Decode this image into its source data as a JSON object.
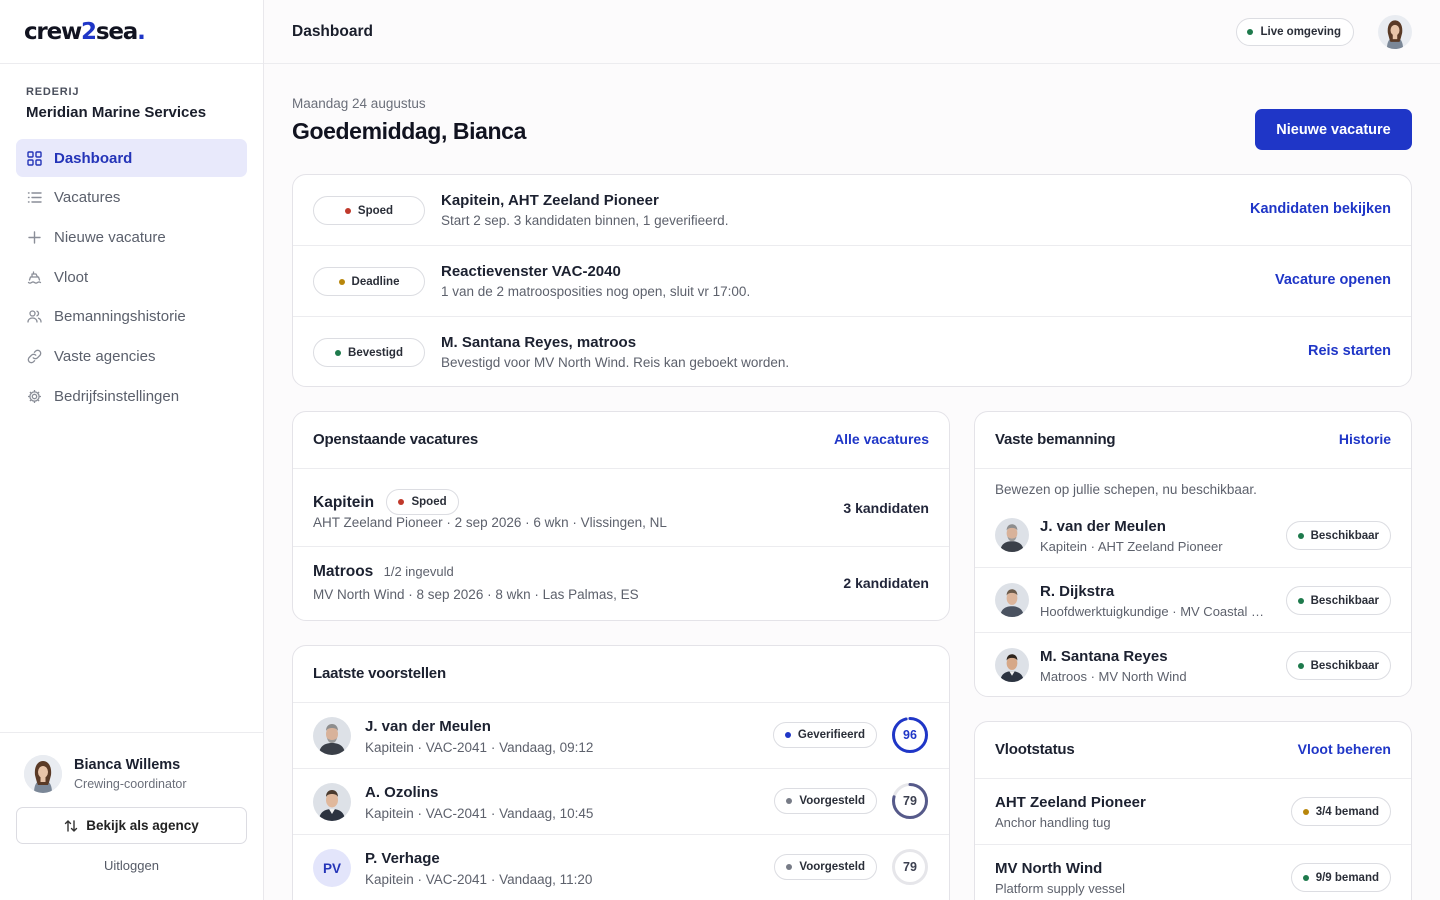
{
  "brand": {
    "prefix": "crew",
    "two": "2",
    "suffix": "sea",
    "dot": "."
  },
  "org": {
    "label": "REDERIJ",
    "name": "Meridian Marine Services"
  },
  "nav": {
    "items": [
      {
        "label": "Dashboard",
        "icon": "grid-icon",
        "active": true
      },
      {
        "label": "Vacatures",
        "icon": "list-icon"
      },
      {
        "label": "Nieuwe vacature",
        "icon": "plus-icon"
      },
      {
        "label": "Vloot",
        "icon": "ship-icon"
      },
      {
        "label": "Bemanningshistorie",
        "icon": "users-icon"
      },
      {
        "label": "Vaste agencies",
        "icon": "link-icon"
      },
      {
        "label": "Bedrijfsinstellingen",
        "icon": "gear-icon"
      }
    ]
  },
  "user": {
    "name": "Bianca Willems",
    "role": "Crewing-coordinator",
    "agency_button": "Bekijk als agency",
    "logout": "Uitloggen"
  },
  "header": {
    "title": "Dashboard",
    "env": "Live omgeving"
  },
  "main": {
    "date": "Maandag 24 augustus",
    "greeting": "Goedemiddag, Bianca",
    "new_button": "Nieuwe vacature"
  },
  "alerts": [
    {
      "badge": "Spoed",
      "title": "Kapitein, AHT Zeeland Pioneer",
      "sub": "Start 2 sep. 3 kandidaten binnen, 1 geverifieerd.",
      "action": "Kandidaten bekijken"
    },
    {
      "badge": "Deadline",
      "title": "Reactievenster VAC-2040",
      "sub": "1 van de 2 matroosposities nog open, sluit vr 17:00.",
      "action": "Vacature openen"
    },
    {
      "badge": "Bevestigd",
      "title": "M. Santana Reyes, matroos",
      "sub": "Bevestigd voor MV North Wind. Reis kan geboekt worden.",
      "action": "Reis starten"
    }
  ],
  "vacancies": {
    "title": "Openstaande vacatures",
    "link": "Alle vacatures",
    "rows": [
      {
        "title": "Kapitein",
        "tag": "Spoed",
        "sub": "AHT Zeeland Pioneer · 2 sep 2026 · 6 wkn · Vlissingen, NL",
        "count": "3 kandidaten"
      },
      {
        "title": "Matroos",
        "tag": "1/2 ingevuld",
        "sub": "MV North Wind · 8 sep 2026 · 8 wkn · Las Palmas, ES",
        "count": "2 kandidaten"
      }
    ]
  },
  "proposals": {
    "title": "Laatste voorstellen",
    "rows": [
      {
        "name": "J. van der Meulen",
        "sub": "Kapitein · VAC-2041 · Vandaag, 09:12",
        "status": "Geverifieerd",
        "score": 96,
        "score_pct": 0.96
      },
      {
        "name": "A. Ozolins",
        "sub": "Kapitein · VAC-2041 · Vandaag, 10:45",
        "status": "Voorgesteld",
        "score": 79,
        "score_pct": 0.79
      },
      {
        "name": "P. Verhage",
        "initials": "PV",
        "sub": "Kapitein · VAC-2041 · Vandaag, 11:20",
        "status": "Voorgesteld",
        "score": 79,
        "score_pct": 0.79
      }
    ]
  },
  "crew": {
    "title": "Vaste bemanning",
    "link": "Historie",
    "intro": "Bewezen op jullie schepen, nu beschikbaar.",
    "rows": [
      {
        "name": "J. van der Meulen",
        "sub": "Kapitein · AHT Zeeland Pioneer",
        "status": "Beschikbaar"
      },
      {
        "name": "R. Dijkstra",
        "sub": "Hoofdwerktuigkundige · MV Coastal Dawn",
        "status": "Beschikbaar"
      },
      {
        "name": "M. Santana Reyes",
        "sub": "Matroos · MV North Wind",
        "status": "Beschikbaar"
      }
    ]
  },
  "fleet": {
    "title": "Vlootstatus",
    "link": "Vloot beheren",
    "rows": [
      {
        "name": "AHT Zeeland Pioneer",
        "sub": "Anchor handling tug",
        "status": "3/4 bemand"
      },
      {
        "name": "MV North Wind",
        "sub": "Platform supply vessel",
        "status": "9/9 bemand"
      }
    ]
  },
  "colors": {
    "accent": "#1f36c7",
    "danger": "#c0392b",
    "warning": "#b8860b",
    "success": "#1e7a4c"
  }
}
